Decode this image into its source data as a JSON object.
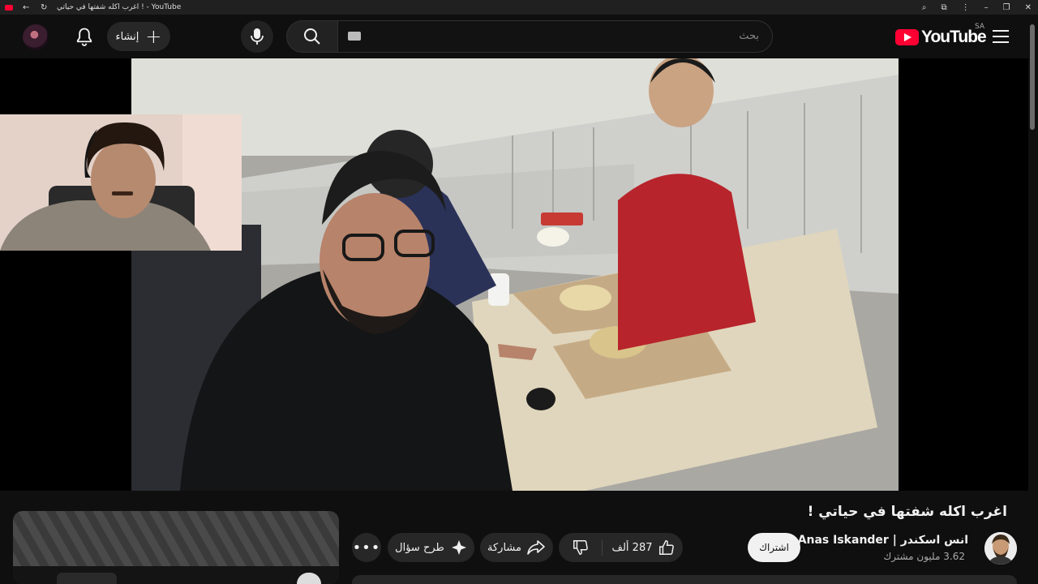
{
  "browser": {
    "page_title": "اغرب اكله شفتها في حياتي ! - YouTube"
  },
  "header": {
    "create_label": "إنشاء",
    "search_placeholder": "بحث",
    "logo_text": "YouTube",
    "region": "SA"
  },
  "video": {
    "title": "اغرب اكله شفتها في حياتي !",
    "channel_name": "انس اسكندر | Anas Iskander",
    "subscribers": "3.62 مليون مشترك",
    "subscribe_label": "اشتراك",
    "likes": "287 ألف",
    "share_label": "مشاركة",
    "ask_label": "طرح سؤال",
    "more_label": "•••"
  },
  "colors": {
    "background": "#0f0f0f",
    "brand_red": "#ff0033",
    "pill": "#272727"
  }
}
